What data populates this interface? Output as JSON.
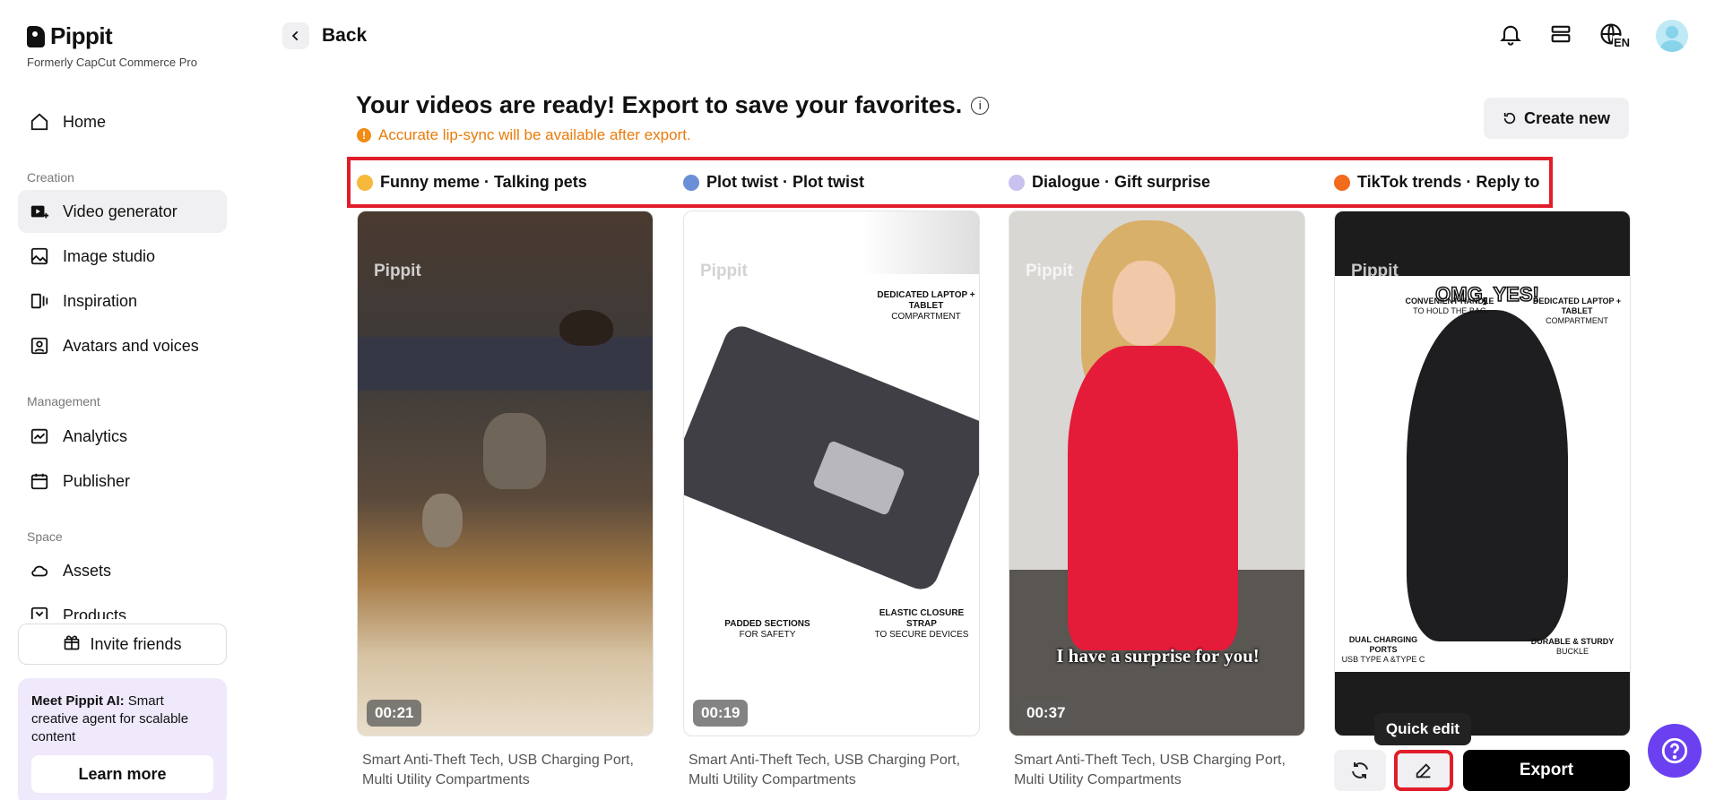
{
  "brand": {
    "name": "Pippit",
    "subtitle": "Formerly CapCut Commerce Pro"
  },
  "sidebar": {
    "home": "Home",
    "sections": [
      "Creation",
      "Management",
      "Space"
    ],
    "items": [
      {
        "label": "Video generator"
      },
      {
        "label": "Image studio"
      },
      {
        "label": "Inspiration"
      },
      {
        "label": "Avatars and voices"
      },
      {
        "label": "Analytics"
      },
      {
        "label": "Publisher"
      },
      {
        "label": "Assets"
      },
      {
        "label": "Products"
      }
    ],
    "invite": "Invite friends",
    "promo": {
      "bold": "Meet Pippit AI:",
      "text": " Smart creative agent for scalable content",
      "button": "Learn more"
    }
  },
  "header": {
    "back": "Back",
    "lang": "EN"
  },
  "main": {
    "title": "Your videos are ready! Export to save your favorites.",
    "notice": "Accurate lip-sync will be available after export.",
    "create_new": "Create new",
    "tabs": [
      {
        "label": "Funny meme · Talking pets",
        "emoji": "😆",
        "color": "#f6b93b"
      },
      {
        "label": "Plot twist · Plot twist",
        "emoji": "🤷",
        "color": "#6b8fd6"
      },
      {
        "label": "Dialogue · Gift surprise",
        "emoji": "💬",
        "color": "#c9c1f0"
      },
      {
        "label": "TikTok trends · Reply to",
        "emoji": "🔥",
        "color": "#f26a1b"
      }
    ],
    "watermark": "Pippit",
    "cards": [
      {
        "duration": "00:21",
        "caption": "Smart Anti-Theft Tech, USB Charging Port, Multi Utility Compartments"
      },
      {
        "duration": "00:19",
        "caption": "Smart Anti-Theft Tech, USB Charging Port, Multi Utility Compartments",
        "labels": {
          "laptop": "DEDICATED LAPTOP + TABLET",
          "laptop_sub": "COMPARTMENT",
          "padded": "PADDED SECTIONS",
          "padded_sub": "FOR SAFETY",
          "strap": "ELASTIC CLOSURE STRAP",
          "strap_sub": "TO SECURE DEVICES"
        }
      },
      {
        "duration": "00:37",
        "caption": "Smart Anti-Theft Tech, USB Charging Port, Multi Utility Compartments",
        "subtitle": "I have a surprise for you!"
      },
      {
        "overlay": "OMG, YES!",
        "labels": {
          "handle": "CONVENIENT HANDLE",
          "handle_sub": "TO HOLD THE BAG",
          "laptop": "DEDICATED LAPTOP + TABLET",
          "laptop_sub": "COMPARTMENT",
          "ports": "DUAL CHARGING PORTS",
          "ports_sub": "USB TYPE A &TYPE C",
          "buckle": "DURABLE & STURDY",
          "buckle_sub": "BUCKLE"
        }
      }
    ],
    "tooltip": "Quick edit",
    "export": "Export"
  },
  "colors": {
    "accent_red": "#e11d2a",
    "help_purple": "#6a40f0",
    "notice_orange": "#e87b0a"
  }
}
